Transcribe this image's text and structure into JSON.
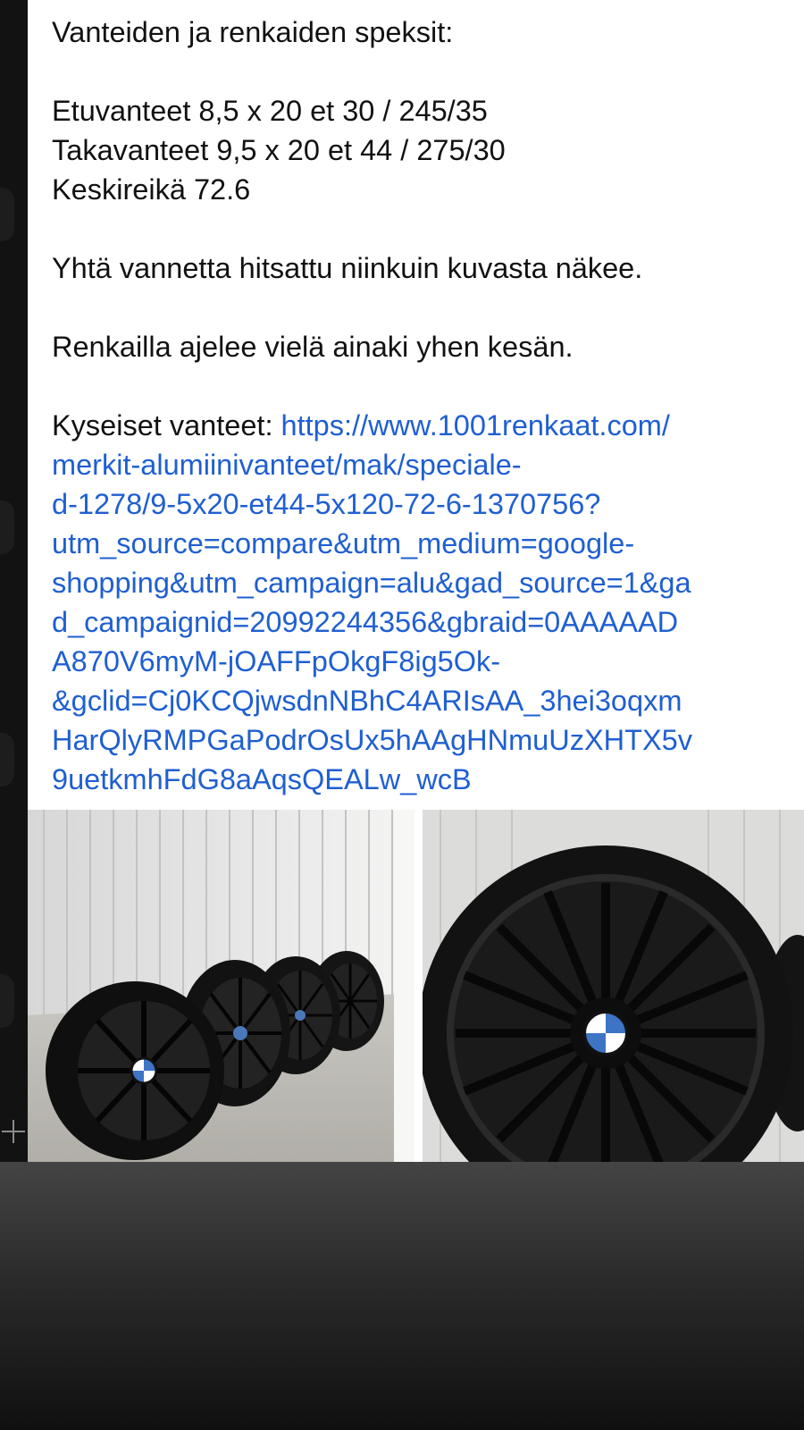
{
  "post": {
    "heading": "Vanteiden ja renkaiden speksit:",
    "specs": [
      "Etuvanteet 8,5 x 20 et 30 / 245/35",
      "Takavanteet 9,5 x 20 et 44 / 275/30",
      "Keskireikä 72.6"
    ],
    "welded_note": "Yhtä vannetta hitsattu niinkuin kuvasta näkee.",
    "tires_note": "Renkailla ajelee vielä ainaki yhen kesän.",
    "link_prefix": "Kyseiset vanteet: ",
    "link_lines": [
      "https://www.1001renkaat.com/",
      "merkit-alumiinivanteet/mak/speciale-",
      "d-1278/9-5x20-et44-5x120-72-6-1370756?",
      "utm_source=compare&utm_medium=google-",
      "shopping&utm_campaign=alu&gad_source=1&ga",
      "d_campaignid=20992244356&gbraid=0AAAAAD",
      "A870V6myM-jOAFFpOkgF8ig5Ok-",
      "&gclid=Cj0KCQjwsdnNBhC4ARIsAA_3hei3oqxm",
      "HarQlyRMPGaPodrOsUx5hAAgHNmuUzXHTX5v",
      "9uetkmhFdG8aAqsQEALw_wcB"
    ]
  },
  "colors": {
    "link": "#1f5fd1",
    "text": "#111111",
    "card_background": "#ffffff"
  },
  "icons": {
    "add": "plus-icon",
    "logo": "bmw-roundel-icon"
  }
}
